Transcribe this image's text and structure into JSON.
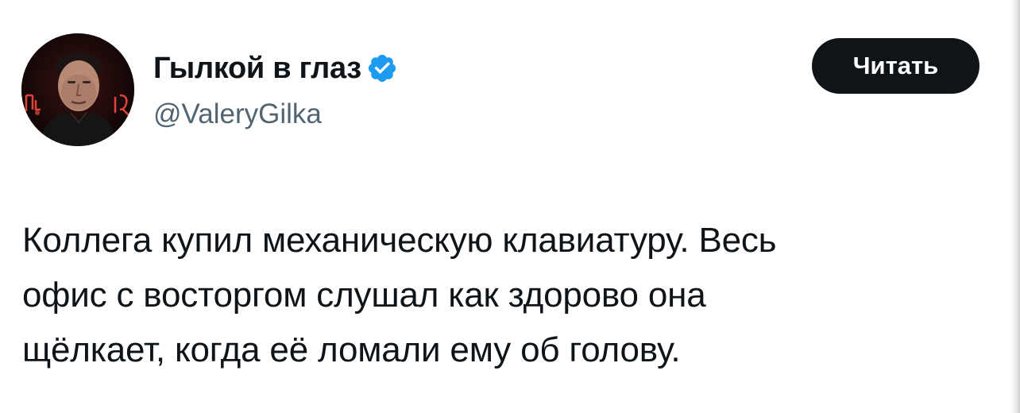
{
  "author": {
    "display_name": "Гылкой в глаз",
    "handle": "@ValeryGilka",
    "verified": true,
    "verified_color": "#1d9bf0",
    "avatar_icon": "user-photo-avatar"
  },
  "actions": {
    "follow_label": "Читать"
  },
  "tweet": {
    "text": "Коллега купил механическую клавиатуру. Весь\nофис с восторгом слушал как здорово она\nщёлкает, когда её ломали ему об голову."
  }
}
